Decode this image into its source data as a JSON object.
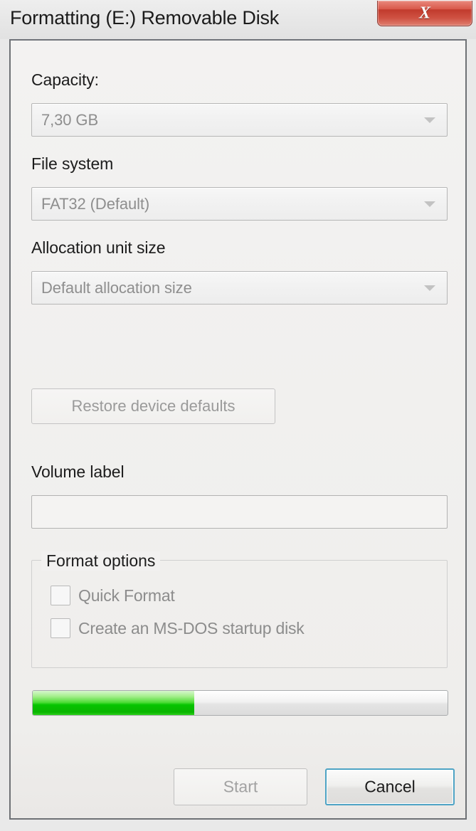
{
  "window": {
    "title": "Formatting (E:) Removable Disk",
    "close_icon": "close-x-icon",
    "close_glyph": "X",
    "accent_close_color": "#c13a2c",
    "focus_border_color": "#4ea3c4"
  },
  "fields": {
    "capacity": {
      "label": "Capacity:",
      "value": "7,30 GB",
      "disabled": true,
      "arrow_icon": "chevron-down-icon"
    },
    "file_system": {
      "label": "File system",
      "value": "FAT32 (Default)",
      "disabled": true,
      "arrow_icon": "chevron-down-icon"
    },
    "allocation_unit_size": {
      "label": "Allocation unit size",
      "value": "Default allocation size",
      "disabled": true,
      "arrow_icon": "chevron-down-icon"
    },
    "volume_label": {
      "label": "Volume label",
      "value": "",
      "placeholder": ""
    }
  },
  "restore_defaults": {
    "label": "Restore device defaults",
    "disabled": true
  },
  "format_options": {
    "legend": "Format options",
    "items": [
      {
        "label": "Quick Format",
        "checked": false,
        "disabled": true
      },
      {
        "label": "Create an MS-DOS startup disk",
        "checked": false,
        "disabled": true
      }
    ]
  },
  "progress": {
    "percent": 39,
    "fill_color": "#06c400"
  },
  "buttons": {
    "start": {
      "label": "Start",
      "disabled": true
    },
    "cancel": {
      "label": "Cancel",
      "disabled": false,
      "focused": true
    }
  }
}
